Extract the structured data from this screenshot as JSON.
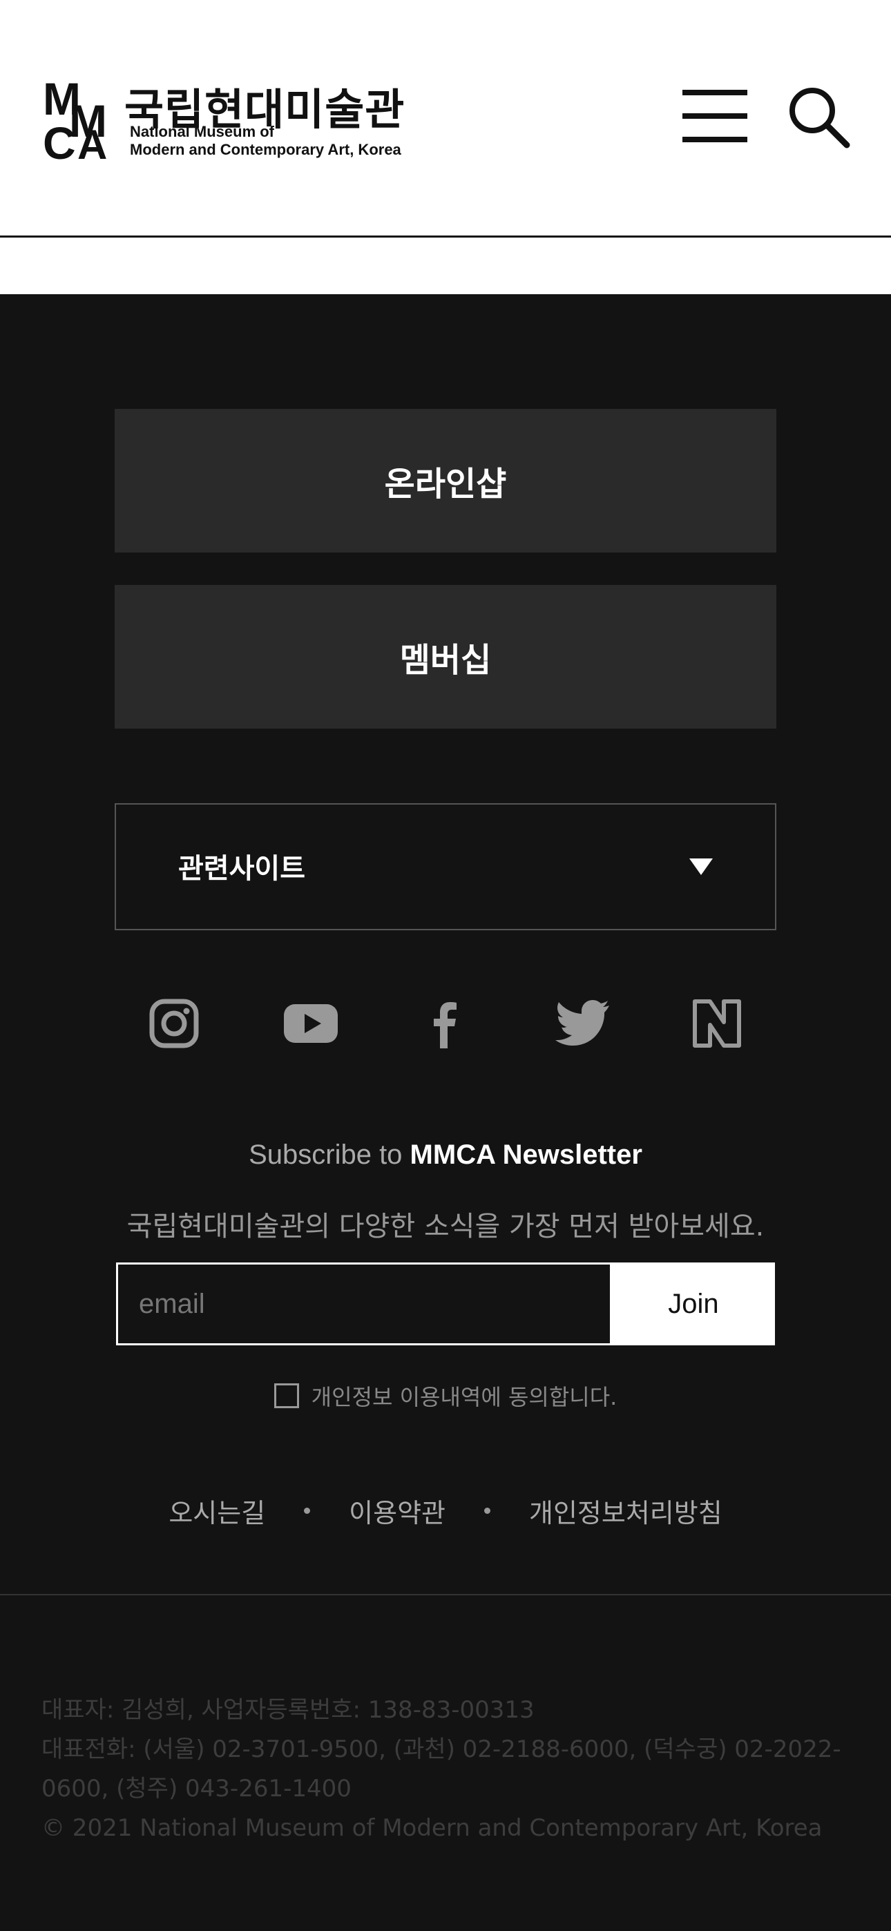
{
  "header": {
    "logo_mark": "MMCA",
    "logo_korean": "국립현대미술관",
    "logo_english_line1": "National Museum of",
    "logo_english_line2": "Modern and Contemporary Art, Korea",
    "menu_icon": "hamburger-menu-icon",
    "search_icon": "search-icon"
  },
  "tiles": {
    "online_shop": "온라인샵",
    "membership": "멤버십"
  },
  "related_sites": {
    "label": "관련사이트",
    "icon": "triangle-down-icon"
  },
  "social": [
    {
      "icon": "instagram-icon"
    },
    {
      "icon": "youtube-icon"
    },
    {
      "icon": "facebook-icon"
    },
    {
      "icon": "twitter-icon"
    },
    {
      "icon": "naver-icon"
    }
  ],
  "newsletter": {
    "prefix": "Subscribe to ",
    "brand": "MMCA Newsletter",
    "description": "국립현대미술관의 다양한 소식을 가장 먼저 받아보세요.",
    "email_placeholder": "email",
    "join_label": "Join",
    "agree_label": "개인정보 이용내역에 동의합니다."
  },
  "footer_links": {
    "directions": "오시는길",
    "terms": "이용약관",
    "privacy": "개인정보처리방침"
  },
  "footer_info": {
    "line1": "대표자: 김성희, 사업자등록번호: 138-83-00313",
    "line2": "대표전화: (서울) 02-3701-9500, (과천) 02-2188-6000, (덕수궁) 02-2022-0600, (청주) 043-261-1400",
    "copyright": "© 2021 National Museum of Modern and Contemporary Art, Korea"
  },
  "colors": {
    "background": "#131313",
    "tile": "#2a2a2a",
    "header": "#ffffff",
    "muted_text": "#aaaaaa",
    "footer_text": "#3d3d3d"
  }
}
